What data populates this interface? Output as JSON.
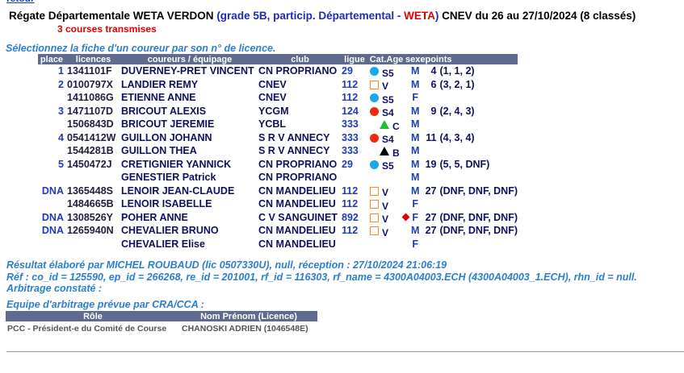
{
  "nav": {
    "retour": "retour"
  },
  "header": {
    "title_main": "Régate Départementale WETA VERDON",
    "title_grade_prefix": " (grade 5B, particip. Départemental - ",
    "title_weta": "WETA",
    "title_grade_suffix": ")",
    "title_club_dates": " CNEV du 26 au 27/10/2024 (8 classés)",
    "courses_transmises": "3 courses transmises",
    "select_hint": "Sélectionnez la fiche d'un coureur par son n° de licence."
  },
  "table": {
    "columns": [
      "place",
      "licences",
      "coureurs / équipage",
      "club",
      "ligue",
      "Cat.Age",
      "sexe",
      "points"
    ],
    "rows": [
      {
        "place": "1",
        "licence": "1341101F",
        "name": "DUVERNEY-PRET VINCENT",
        "club": "CN PROPRIANO",
        "ligue": "29",
        "cat_icon": "circle-blue",
        "cat": "S5",
        "sexe": "M",
        "points": "4",
        "detail": "(1, 1, 2)"
      },
      {
        "place": "2",
        "licence": "0100797X",
        "name": "LANDIER REMY",
        "club": "CNEV",
        "ligue": "112",
        "cat_icon": "square-orange",
        "cat": "V",
        "sexe": "M",
        "points": "6",
        "detail": "(3, 2, 1)"
      },
      {
        "place": "",
        "licence": "1411086G",
        "name": "ETIENNE ANNE",
        "club": "CNEV",
        "ligue": "112",
        "cat_icon": "circle-blue",
        "cat": "S5",
        "sexe": "F",
        "points": "",
        "detail": ""
      },
      {
        "place": "3",
        "licence": "1471107D",
        "name": "BRICOUT ALEXIS",
        "club": "YCGM",
        "ligue": "124",
        "cat_icon": "circle-red",
        "cat": "S4",
        "sexe": "M",
        "points": "9",
        "detail": "(2, 4, 3)"
      },
      {
        "place": "",
        "licence": "1506843D",
        "name": "BRICOUT JEREMIE",
        "club": "YCBL",
        "ligue": "333",
        "cat_icon": "triangle-green",
        "cat": "C",
        "sexe": "M",
        "points": "",
        "detail": ""
      },
      {
        "place": "4",
        "licence": "0541412W",
        "name": "GUILLON JOHANN",
        "club": "S R V ANNECY",
        "ligue": "333",
        "cat_icon": "circle-red",
        "cat": "S4",
        "sexe": "M",
        "points": "11",
        "detail": "(4, 3, 4)"
      },
      {
        "place": "",
        "licence": "1544281B",
        "name": "GUILLON THEA",
        "club": "S R V ANNECY",
        "ligue": "333",
        "cat_icon": "triangle-black",
        "cat": "B",
        "sexe": "M",
        "points": "",
        "detail": ""
      },
      {
        "place": "5",
        "licence": "1450472J",
        "name": "CRETIGNIER YANNICK",
        "club": "CN PROPRIANO",
        "ligue": "29",
        "cat_icon": "circle-blue",
        "cat": "S5",
        "sexe": "M",
        "points": "19",
        "detail": "(5, 5, DNF)"
      },
      {
        "place": "",
        "licence": "",
        "name": "GENESTIER Patrick",
        "club": "CN PROPRIANO",
        "ligue": "",
        "cat_icon": "",
        "cat": "",
        "sexe": "M",
        "points": "",
        "detail": ""
      },
      {
        "place": "DNA",
        "licence": "1365448S",
        "name": "LENOIR JEAN-CLAUDE",
        "club": "CN MANDELIEU",
        "ligue": "112",
        "cat_icon": "square-orange",
        "cat": "V",
        "sexe": "M",
        "points": "27",
        "detail": "(DNF, DNF, DNF)"
      },
      {
        "place": "",
        "licence": "1484665B",
        "name": "LENOIR ISABELLE",
        "club": "CN MANDELIEU",
        "ligue": "112",
        "cat_icon": "square-orange",
        "cat": "V",
        "sexe": "F",
        "points": "",
        "detail": ""
      },
      {
        "place": "DNA",
        "licence": "1308526Y",
        "name": "POHER ANNE",
        "club": "C V SANGUINET",
        "ligue": "892",
        "cat_icon": "square-orange",
        "cat": "V",
        "sexe": "F",
        "points": "27",
        "detail": "(DNF, DNF, DNF)",
        "marker": "diamond-red"
      },
      {
        "place": "DNA",
        "licence": "1265940N",
        "name": "CHEVALIER BRUNO",
        "club": "CN MANDELIEU",
        "ligue": "112",
        "cat_icon": "square-orange",
        "cat": "V",
        "sexe": "M",
        "points": "27",
        "detail": "(DNF, DNF, DNF)"
      },
      {
        "place": "",
        "licence": "",
        "name": "CHEVALIER Elise",
        "club": "CN MANDELIEU",
        "ligue": "",
        "cat_icon": "",
        "cat": "",
        "sexe": "F",
        "points": "",
        "detail": ""
      }
    ]
  },
  "footer": {
    "resultat": "Résultat élaboré par MICHEL ROUBAUD (lic 0507330U), null, réception : 27/10/2024 21:06:19",
    "ref": "Réf : co_id = 125590, ep_id = 266268, re_id = 201001, rf_id = 116303, rf_name = 4300A04003.ECH (4300A04003_1.ECH), rhn_id = null.",
    "arbitrage_constate": "Arbitrage constaté :",
    "equipe_title": "Equipe d'arbitrage prévue par CRA/CCA :",
    "arb_columns": [
      "Rôle",
      "Nom Prénom (Licence)"
    ],
    "arb_rows": [
      {
        "role": "PCC - Président-e du Comité de Course",
        "name": "CHANOSKI ADRIEN (1046548E)"
      }
    ]
  },
  "colors": {
    "header_bg": "#5e6a8e",
    "accent_blue": "#2a7fd0",
    "red": "#e00000"
  }
}
